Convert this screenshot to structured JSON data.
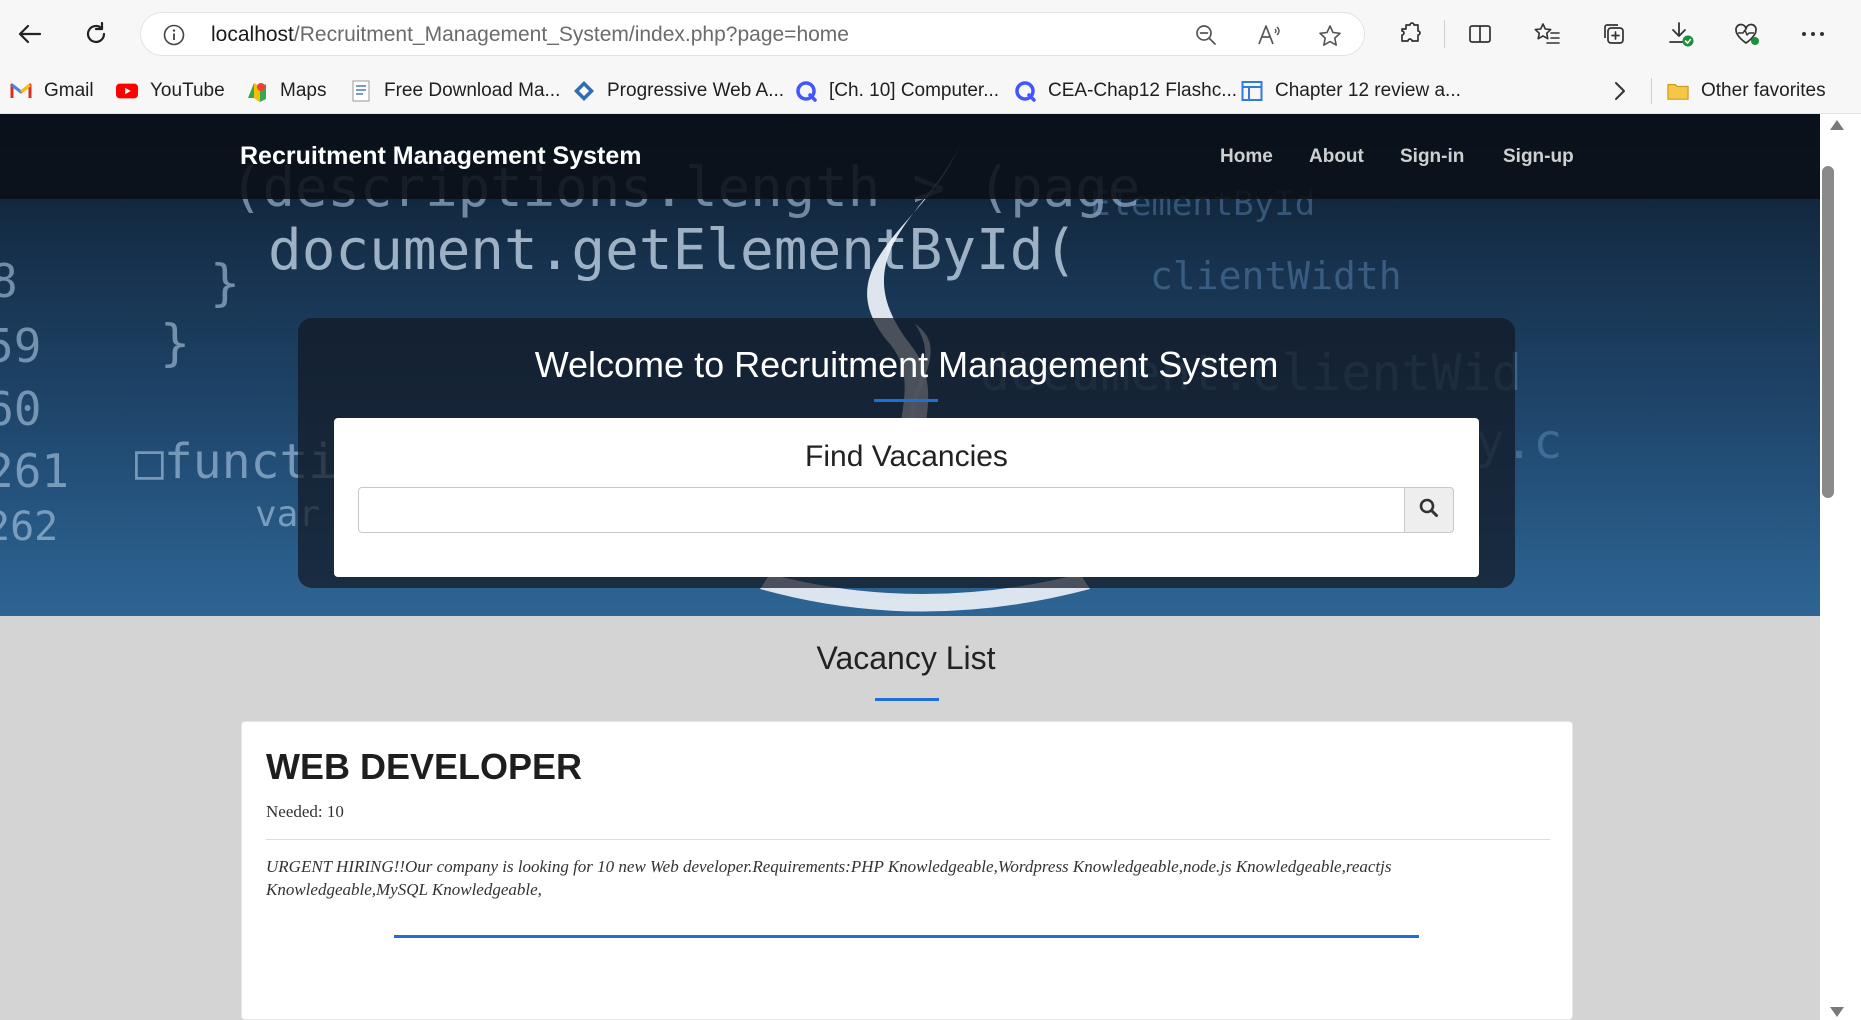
{
  "browser": {
    "url_host": "localhost",
    "url_path": "/Recruitment_Management_System/index.php?page=home",
    "icons": {
      "back": "back-arrow-icon",
      "refresh": "refresh-icon",
      "info": "info-icon",
      "zoom": "zoom-out-icon",
      "read_aloud": "read-aloud-icon",
      "favorite": "star-icon",
      "extensions": "puzzle-icon",
      "split": "split-screen-icon",
      "favorites": "favorites-icon",
      "collections": "collections-icon",
      "downloads": "download-icon",
      "health": "heart-pulse-icon",
      "more": "more-icon"
    }
  },
  "bookmarks": [
    {
      "label": "Gmail",
      "icon": "gmail-icon"
    },
    {
      "label": "YouTube",
      "icon": "youtube-icon"
    },
    {
      "label": "Maps",
      "icon": "maps-icon"
    },
    {
      "label": "Free Download Ma...",
      "icon": "document-icon"
    },
    {
      "label": "Progressive Web A...",
      "icon": "diamond-icon"
    },
    {
      "label": "[Ch. 10] Computer...",
      "icon": "quizlet-icon"
    },
    {
      "label": "CEA-Chap12 Flashc...",
      "icon": "quizlet-icon"
    },
    {
      "label": "Chapter 12 review a...",
      "icon": "window-icon"
    }
  ],
  "bookmarks_overflow": "chevron-right-icon",
  "other_favorites": {
    "label": "Other favorites",
    "icon": "folder-icon"
  },
  "site": {
    "brand": "Recruitment Management System",
    "nav": [
      "Home",
      "About",
      "Sign-in",
      "Sign-up"
    ],
    "welcome": "Welcome to Recruitment Management System",
    "search_title": "Find Vacancies",
    "search_value": "",
    "search_icon": "search-icon"
  },
  "vacancies": {
    "heading": "Vacancy List",
    "items": [
      {
        "title": "WEB DEVELOPER",
        "needed_label": "Needed: 10",
        "description": "URGENT HIRING!!Our company is looking for 10 new Web developer.Requirements:PHP Knowledgeable,Wordpress Knowledgeable,node.js Knowledgeable,reactjs Knowledgeable,MySQL Knowledgeable,"
      }
    ]
  },
  "colors": {
    "accent": "#1f6fd6",
    "page_background": "#d4d4d4",
    "navbar": "#0a1018"
  }
}
